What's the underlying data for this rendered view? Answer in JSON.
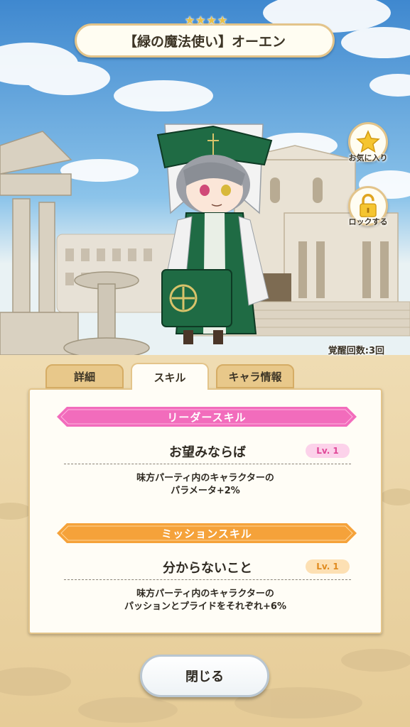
{
  "character": {
    "title": "【緑の魔法使い】オーエン",
    "rarity_stars": [
      "★",
      "★",
      "★",
      "★"
    ]
  },
  "side_buttons": {
    "favorite_label": "お気に入り",
    "lock_label": "ロックする"
  },
  "awakening_text": "覚醒回数:3回",
  "tabs": [
    {
      "label": "詳細",
      "active": false
    },
    {
      "label": "スキル",
      "active": true
    },
    {
      "label": "キャラ情報",
      "active": false
    }
  ],
  "leader_skill": {
    "header": "リーダースキル",
    "name": "お望みならば",
    "level": "Lv. 1",
    "desc_line1": "味方パーティ内のキャラクターの",
    "desc_line2": "パラメータ+2%"
  },
  "mission_skill": {
    "header": "ミッションスキル",
    "name": "分からないこと",
    "level": "Lv. 1",
    "desc_line1": "味方パーティ内のキャラクターの",
    "desc_line2": "パッションとプライドをそれぞれ+6%"
  },
  "close_label": "閉じる",
  "colors": {
    "leader_banner": "#f26cbc",
    "mission_banner": "#f5a23a",
    "panel_border": "#e3c48a",
    "character_green": "#1f6b44"
  },
  "icons": [
    "star-icon",
    "padlock-icon"
  ]
}
